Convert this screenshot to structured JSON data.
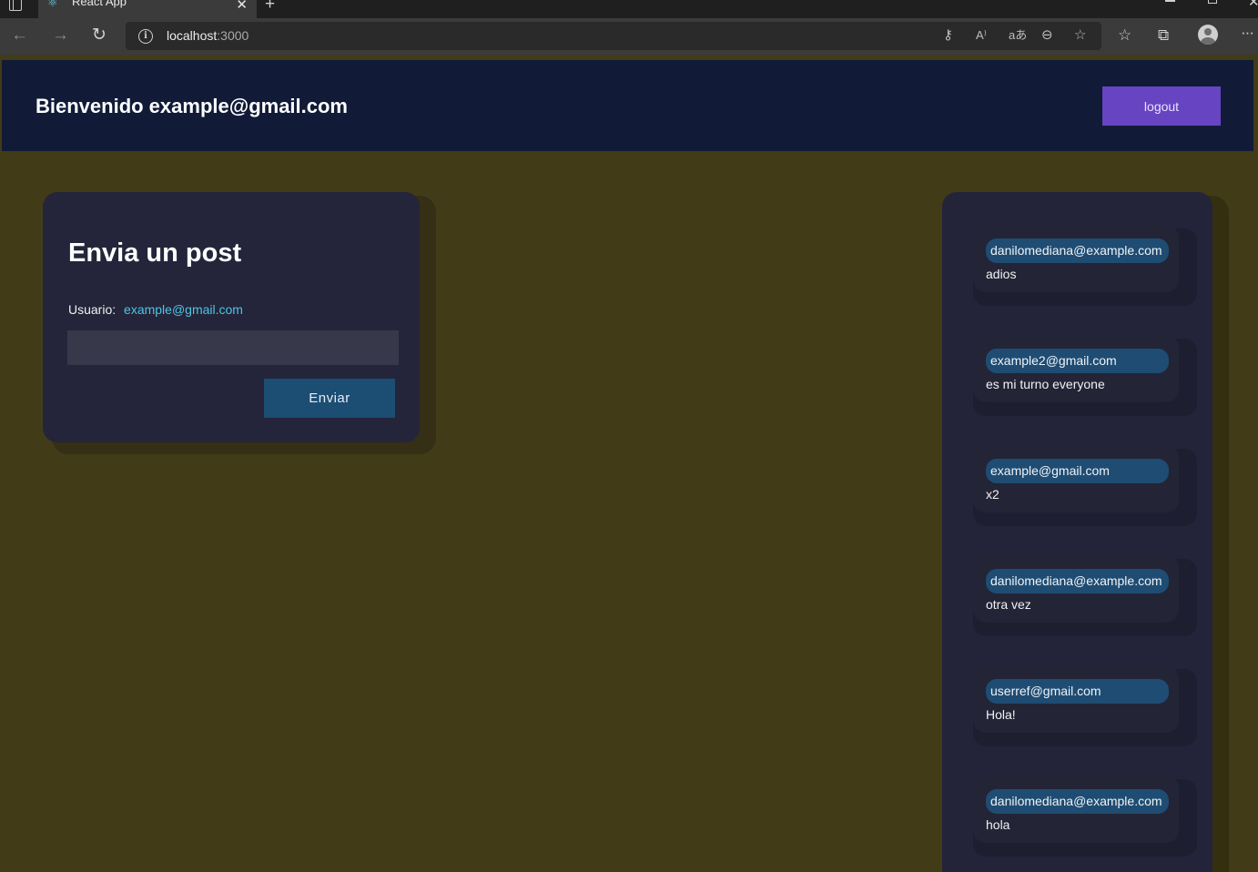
{
  "browser": {
    "tab_title": "React App",
    "url_host": "localhost",
    "url_port": ":3000"
  },
  "header": {
    "welcome": "Bienvenido example@gmail.com",
    "logout_label": "logout"
  },
  "form": {
    "title": "Envia un post",
    "user_label": "Usuario:",
    "user_email": "example@gmail.com",
    "input_value": "",
    "send_label": "Enviar"
  },
  "posts": [
    {
      "author": "danilomediana@example.com",
      "text": "adios"
    },
    {
      "author": "example2@gmail.com",
      "text": "es mi turno everyone"
    },
    {
      "author": "example@gmail.com",
      "text": "x2"
    },
    {
      "author": "danilomediana@example.com",
      "text": "otra vez"
    },
    {
      "author": "userref@gmail.com",
      "text": "Hola!"
    },
    {
      "author": "danilomediana@example.com",
      "text": "hola"
    }
  ],
  "colors": {
    "page_bg": "#413b18",
    "header_bg": "#111b38",
    "logout_bg": "#6744c2",
    "card_bg": "#24253a",
    "send_bg": "#1c4d72",
    "author_pill": "#1f4c72",
    "email_link": "#4fc3e3"
  }
}
